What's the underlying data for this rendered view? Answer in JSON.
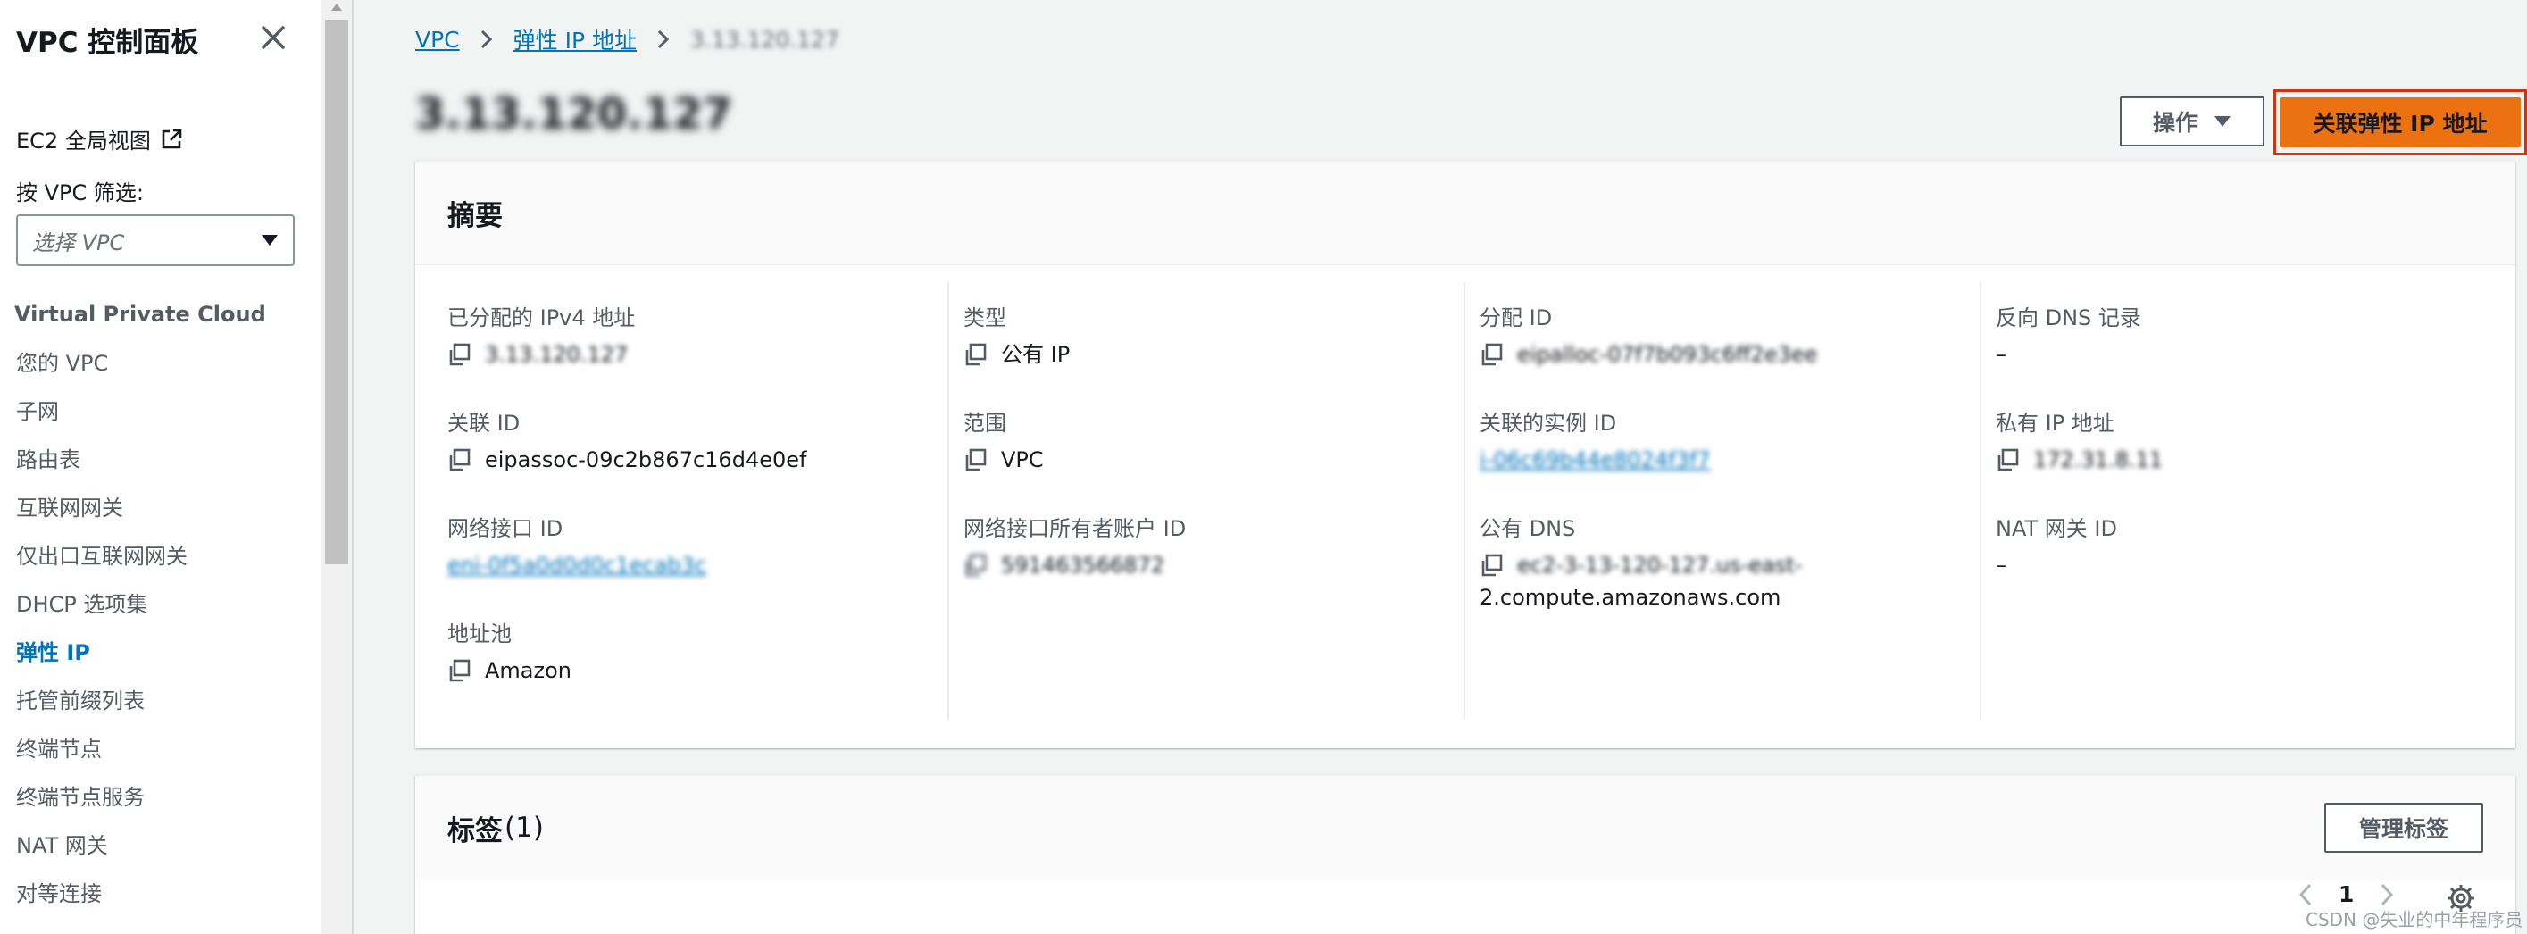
{
  "sidebar": {
    "title": "VPC 控制面板",
    "global_view_link": "EC2 全局视图",
    "filter_label": "按 VPC 筛选:",
    "filter_placeholder": "选择 VPC",
    "section_title": "Virtual Private Cloud",
    "items": [
      {
        "label": "您的 VPC"
      },
      {
        "label": "子网"
      },
      {
        "label": "路由表"
      },
      {
        "label": "互联网网关"
      },
      {
        "label": "仅出口互联网网关"
      },
      {
        "label": "DHCP 选项集"
      },
      {
        "label": "弹性 IP"
      },
      {
        "label": "托管前缀列表"
      },
      {
        "label": "终端节点"
      },
      {
        "label": "终端节点服务"
      },
      {
        "label": "NAT 网关"
      },
      {
        "label": "对等连接"
      }
    ],
    "active_item": "弹性 IP"
  },
  "breadcrumb": {
    "items": [
      "VPC",
      "弹性 IP 地址"
    ],
    "current": "3.13.120.127"
  },
  "page": {
    "title": "3.13.120.127",
    "actions_label": "操作",
    "primary_label": "关联弹性 IP 地址"
  },
  "summary": {
    "title": "摘要",
    "fields": {
      "allocated_ipv4_label": "已分配的 IPv4 地址",
      "allocated_ipv4_value": "3.13.120.127",
      "type_label": "类型",
      "type_value": "公有 IP",
      "allocation_id_label": "分配 ID",
      "allocation_id_value": "eipalloc-07f7b093c6ff2e3ee",
      "reverse_dns_label": "反向 DNS 记录",
      "reverse_dns_value": "–",
      "association_id_label": "关联 ID",
      "association_id_value": "eipassoc-09c2b867c16d4e0ef",
      "scope_label": "范围",
      "scope_value": "VPC",
      "instance_id_label": "关联的实例 ID",
      "instance_id_value": "i-06c69b44e8024f3f7",
      "private_ip_label": "私有 IP 地址",
      "private_ip_value": "172.31.8.11",
      "eni_id_label": "网络接口 ID",
      "eni_id_value": "eni-0f5a0d0d0c1ecab3c",
      "eni_owner_label": "网络接口所有者账户 ID",
      "eni_owner_value": "591463566872",
      "public_dns_label": "公有 DNS",
      "public_dns_value_1": "ec2-3-13-120-127.us-east-",
      "public_dns_value_2": "2.compute.amazonaws.com",
      "nat_label": "NAT 网关 ID",
      "nat_value": "–",
      "pool_label": "地址池",
      "pool_value": "Amazon"
    }
  },
  "tags": {
    "title": "标签",
    "count": "(1)",
    "manage_label": "管理标签",
    "page_number": "1"
  },
  "watermark": "CSDN @失业的中年程序员",
  "colors": {
    "primary": "#ec7211",
    "link": "#0073bb",
    "highlight_border": "#d13212"
  }
}
